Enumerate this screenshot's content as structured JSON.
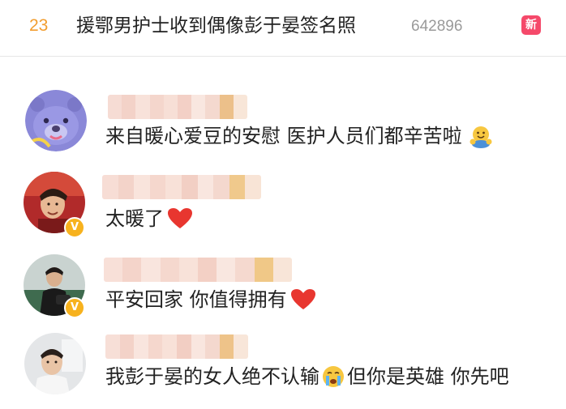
{
  "trend": {
    "rank": "23",
    "title": "援鄂男护士收到偶像彭于晏签名照",
    "count": "642896",
    "badge": "新"
  },
  "comments": [
    {
      "text": "来自暖心爱豆的安慰 医护人员们都辛苦啦",
      "emoji": "hugging-face-icon",
      "verified": false
    },
    {
      "text": "太暖了",
      "emoji": "red-heart-icon",
      "verified": true
    },
    {
      "text": "平安回家 你值得拥有",
      "emoji": "red-heart-icon",
      "verified": true
    },
    {
      "text_before": "我彭于晏的女人绝不认输",
      "emoji": "crying-face-icon",
      "text_after": "但你是英雄 你先吧",
      "verified": false
    }
  ],
  "colors": {
    "rank": "#f29d2f",
    "badge": "#f5496a",
    "verified_badge": "#f7b21e",
    "count": "#9a9a9a"
  }
}
